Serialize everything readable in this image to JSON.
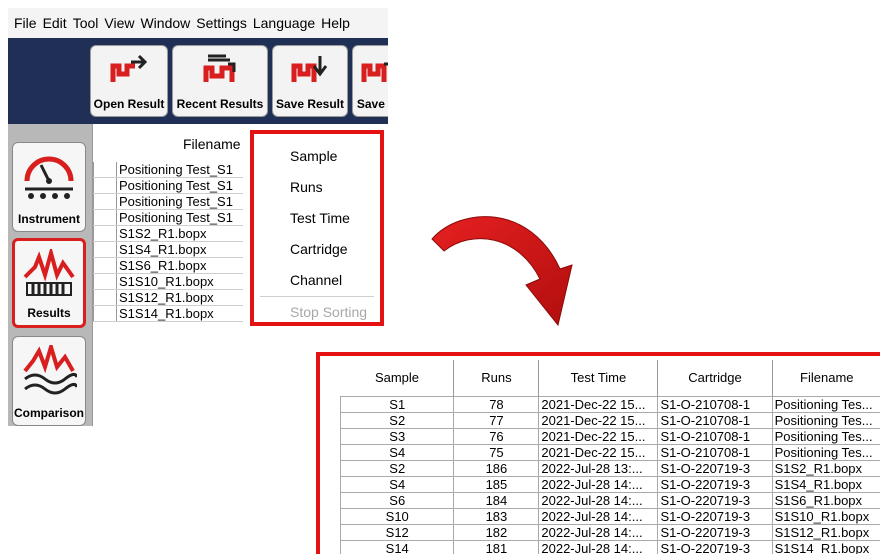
{
  "menubar": [
    "File",
    "Edit",
    "Tool",
    "View",
    "Window",
    "Settings",
    "Language",
    "Help"
  ],
  "toolbar": {
    "open_result": "Open Result",
    "recent_results": "Recent Results",
    "save_result": "Save Result",
    "save_as": "Save As"
  },
  "sidebar": {
    "instrument": "Instrument",
    "results": "Results",
    "comparison": "Comparison"
  },
  "filelist": {
    "header": "Filename",
    "rows": [
      "Positioning Test_S1",
      "Positioning Test_S1",
      "Positioning Test_S1",
      "Positioning Test_S1",
      "S1S2_R1.bopx",
      "S1S4_R1.bopx",
      "S1S6_R1.bopx",
      "S1S10_R1.bopx",
      "S1S12_R1.bopx",
      "S1S14_R1.bopx"
    ]
  },
  "context_menu": {
    "sample": "Sample",
    "runs": "Runs",
    "test_time": "Test Time",
    "cartridge": "Cartridge",
    "channel": "Channel",
    "stop_sorting": "Stop Sorting"
  },
  "sorted_table": {
    "headers": [
      "Sample",
      "Runs",
      "Test Time",
      "Cartridge",
      "Filename"
    ],
    "rows": [
      [
        "S1",
        "78",
        "2021-Dec-22 15...",
        "S1-O-210708-1",
        "Positioning Tes..."
      ],
      [
        "S2",
        "77",
        "2021-Dec-22 15...",
        "S1-O-210708-1",
        "Positioning Tes..."
      ],
      [
        "S3",
        "76",
        "2021-Dec-22 15...",
        "S1-O-210708-1",
        "Positioning Tes..."
      ],
      [
        "S4",
        "75",
        "2021-Dec-22 15...",
        "S1-O-210708-1",
        "Positioning Tes..."
      ],
      [
        "S2",
        "186",
        "2022-Jul-28 13:...",
        "S1-O-220719-3",
        "S1S2_R1.bopx"
      ],
      [
        "S4",
        "185",
        "2022-Jul-28 14:...",
        "S1-O-220719-3",
        "S1S4_R1.bopx"
      ],
      [
        "S6",
        "184",
        "2022-Jul-28 14:...",
        "S1-O-220719-3",
        "S1S6_R1.bopx"
      ],
      [
        "S10",
        "183",
        "2022-Jul-28 14:...",
        "S1-O-220719-3",
        "S1S10_R1.bopx"
      ],
      [
        "S12",
        "182",
        "2022-Jul-28 14:...",
        "S1-O-220719-3",
        "S1S12_R1.bopx"
      ],
      [
        "S14",
        "181",
        "2022-Jul-28 14:...",
        "S1-O-220719-3",
        "S1S14_R1.bopx"
      ]
    ]
  },
  "colors": {
    "highlight": "#e41212",
    "toolbar_bg": "#1f2f55",
    "icon_red": "#d81e1e"
  }
}
